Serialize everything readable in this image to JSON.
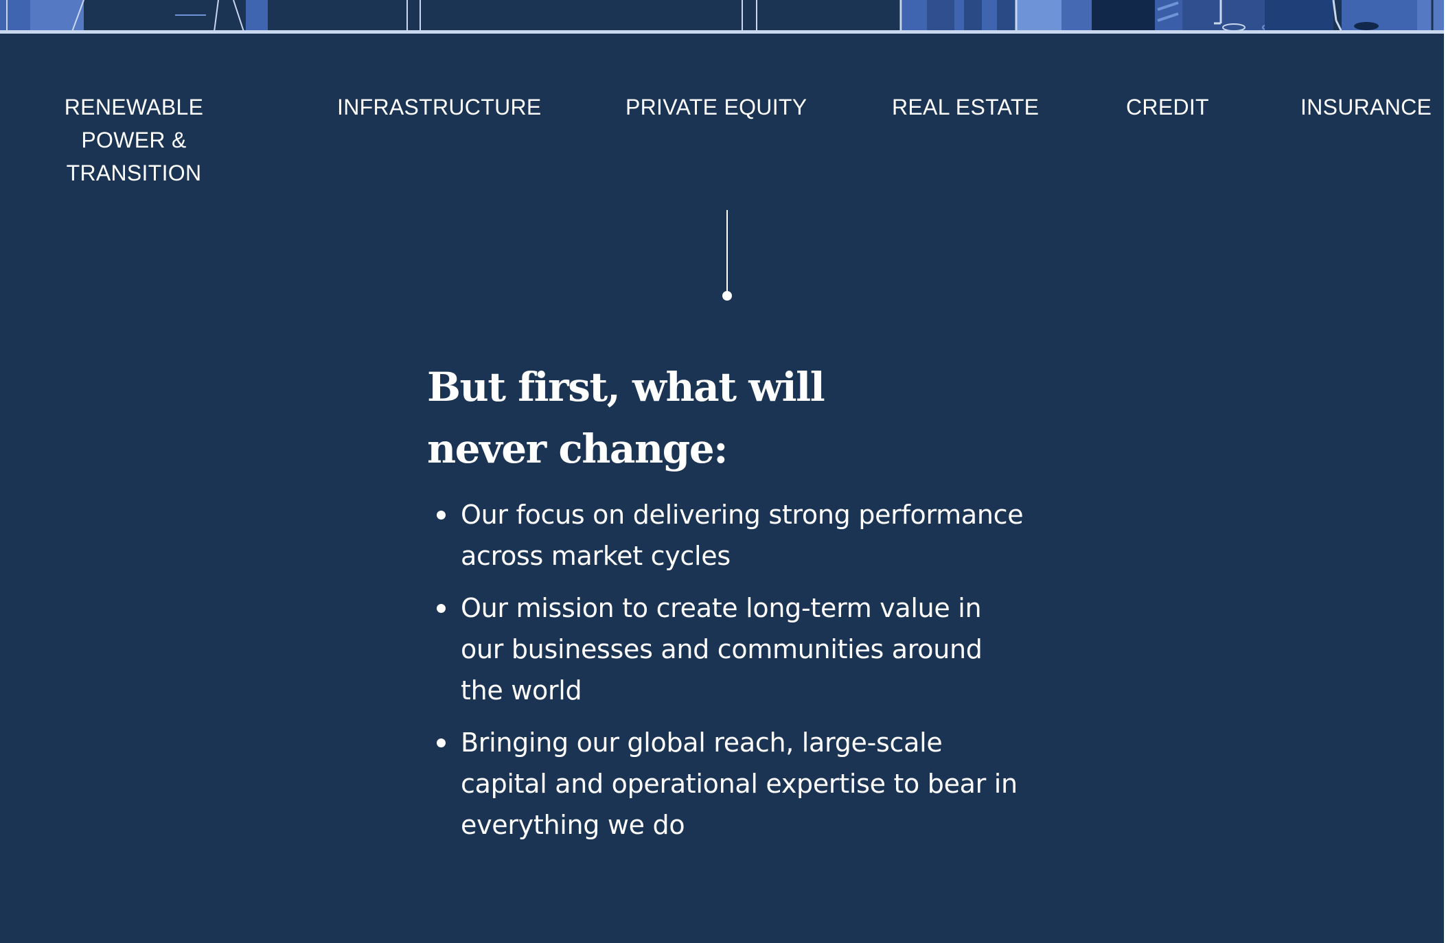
{
  "colors": {
    "panel_background": "#1b3453",
    "text": "#ffffff",
    "skyline_accent": "#3f65b0",
    "skyline_light": "#6e93d6",
    "skyline_line": "#c9d8ee"
  },
  "sector_nav": {
    "items": [
      {
        "label": "RENEWABLE POWER & TRANSITION"
      },
      {
        "label": "INFRASTRUCTURE"
      },
      {
        "label": "PRIVATE EQUITY"
      },
      {
        "label": "REAL ESTATE"
      },
      {
        "label": "CREDIT"
      },
      {
        "label": "INSURANCE"
      }
    ]
  },
  "main": {
    "heading": "But first, what will never change:",
    "values": [
      "Our focus on delivering strong performance across market cycles",
      "Our mission to create long-term value in our businesses and communities around the world",
      "Bringing our global reach, large-scale capital and operational expertise to bear in everything we do"
    ]
  }
}
